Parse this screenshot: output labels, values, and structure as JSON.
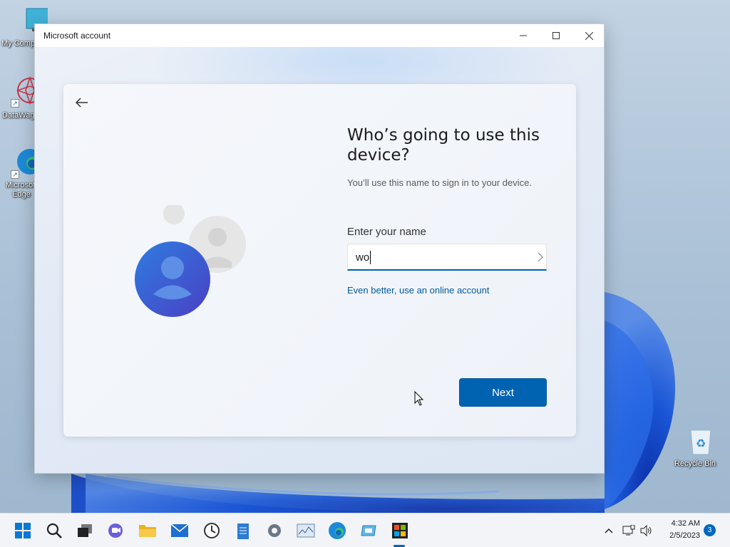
{
  "desktop": {
    "icons": [
      {
        "label": "My Computer"
      },
      {
        "label": "DataWagon"
      },
      {
        "label": "Microsoft Edge"
      },
      {
        "label": "Recycle Bin"
      }
    ]
  },
  "window": {
    "title": "Microsoft account"
  },
  "oobe": {
    "heading": "Who’s going to use this device?",
    "subtext": "You’ll use this name to sign in to your device.",
    "field_label": "Enter your name",
    "name_value": "wo",
    "online_link": "Even better, use an online account",
    "next_label": "Next"
  },
  "taskbar": {
    "time": "4:32 AM",
    "date": "2/5/2023",
    "notification_count": "3",
    "apps": [
      "start-icon",
      "search-icon",
      "task-view-icon",
      "chat-icon",
      "file-explorer-icon",
      "mail-icon",
      "clock-icon",
      "notepad-icon",
      "settings-icon",
      "monitor-icon",
      "edge-icon",
      "app-icon",
      "store-icon"
    ]
  },
  "colors": {
    "accent": "#0063b1",
    "link": "#005a9e"
  }
}
